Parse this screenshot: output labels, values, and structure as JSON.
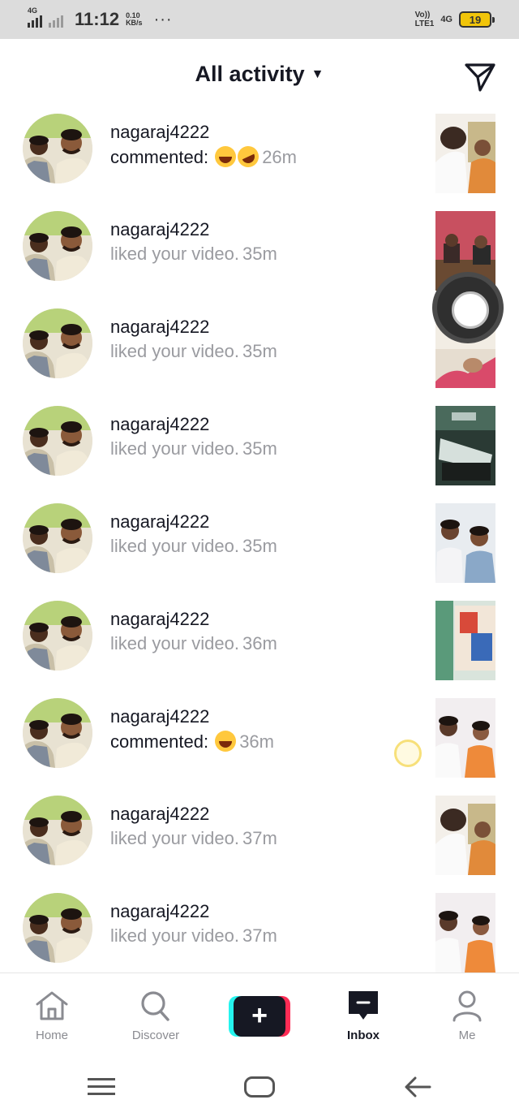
{
  "status_bar": {
    "network_type": "4G",
    "time": "11:12",
    "speed_value": "0.10",
    "speed_unit": "KB/s",
    "more": "···",
    "volte_top": "Vo))",
    "volte_bottom": "LTE1",
    "network_type_right": "4G",
    "battery": "19"
  },
  "header": {
    "title": "All activity",
    "caret": "▼",
    "dm_icon": "paper-plane-icon"
  },
  "notifications": [
    {
      "username": "nagaraj4222",
      "type": "commented",
      "text": "commented:",
      "emojis": [
        "joy",
        "rofl"
      ],
      "time": "26m"
    },
    {
      "username": "nagaraj4222",
      "type": "liked",
      "text": "liked your video.",
      "time": "35m"
    },
    {
      "username": "nagaraj4222",
      "type": "liked",
      "text": "liked your video.",
      "time": "35m"
    },
    {
      "username": "nagaraj4222",
      "type": "liked",
      "text": "liked your video.",
      "time": "35m"
    },
    {
      "username": "nagaraj4222",
      "type": "liked",
      "text": "liked your video.",
      "time": "35m"
    },
    {
      "username": "nagaraj4222",
      "type": "liked",
      "text": "liked your video.",
      "time": "36m"
    },
    {
      "username": "nagaraj4222",
      "type": "commented",
      "text": "commented:",
      "emojis": [
        "joy"
      ],
      "time": "36m"
    },
    {
      "username": "nagaraj4222",
      "type": "liked",
      "text": "liked your video.",
      "time": "37m"
    },
    {
      "username": "nagaraj4222",
      "type": "liked",
      "text": "liked your video.",
      "time": "37m"
    }
  ],
  "bottom_nav": {
    "home": "Home",
    "discover": "Discover",
    "create": "+",
    "inbox": "Inbox",
    "me": "Me"
  },
  "colors": {
    "accent_cyan": "#25f4ee",
    "accent_red": "#fe2c55",
    "text_primary": "#161823",
    "text_secondary": "#9a9ba0"
  }
}
